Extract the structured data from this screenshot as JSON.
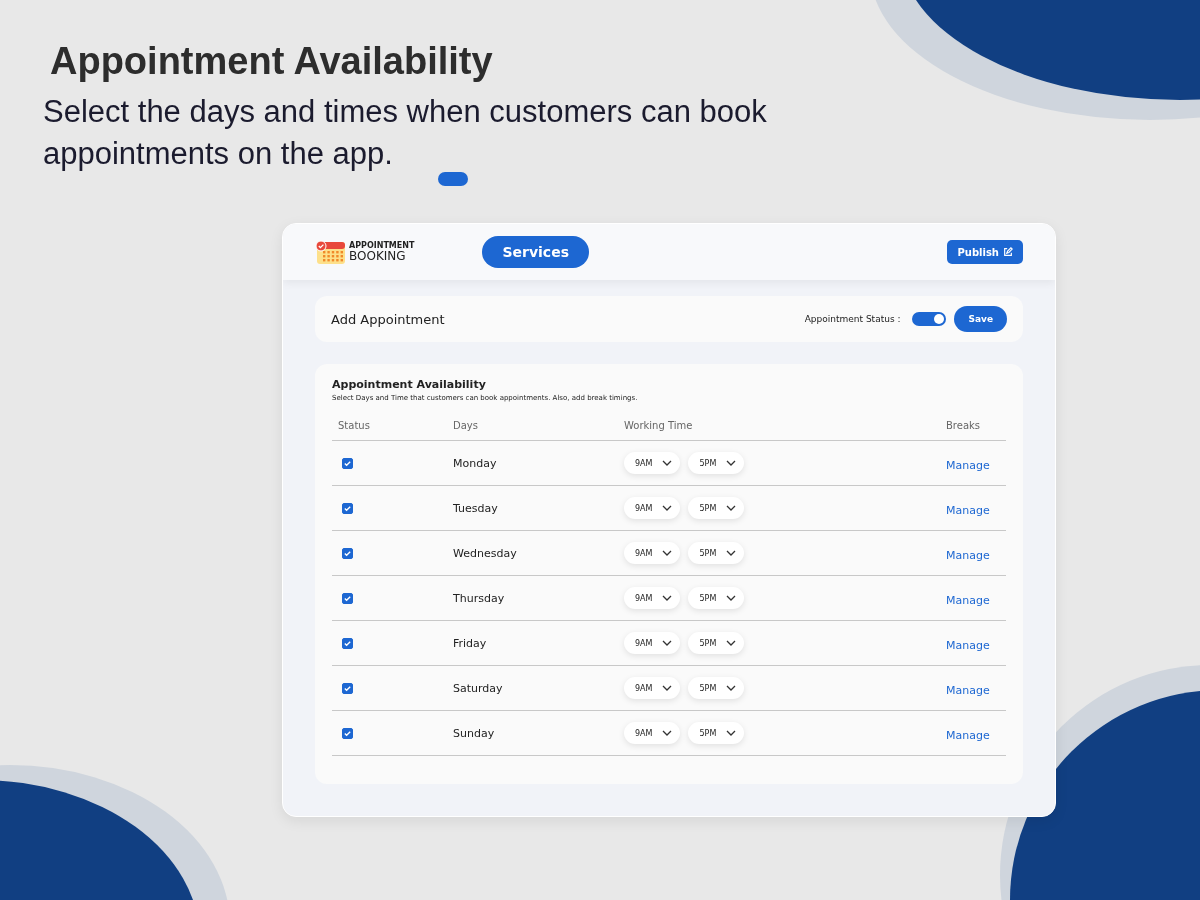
{
  "headline": "Appointment Availability",
  "subtitle": "Select the days and times when customers can book appointments on the app.",
  "app": {
    "logo": {
      "line_1": "APPOINTMENT",
      "line_2": "BOOKING"
    },
    "nav_button": "Services",
    "publish_button": "Publish",
    "add_bar": {
      "title": "Add Appointment",
      "status_label": "Appointment Status :",
      "status_on": true,
      "save_button": "Save"
    },
    "availability": {
      "title": "Appointment Availability",
      "description": "Select Days and Time that customers can book appointments. Also, add break timings.",
      "columns": [
        "Status",
        "Days",
        "Working Time",
        "Breaks"
      ],
      "rows": [
        {
          "checked": true,
          "day": "Monday",
          "start": "9AM",
          "end": "5PM",
          "breaks": "Manage"
        },
        {
          "checked": true,
          "day": "Tuesday",
          "start": "9AM",
          "end": "5PM",
          "breaks": "Manage"
        },
        {
          "checked": true,
          "day": "Wednesday",
          "start": "9AM",
          "end": "5PM",
          "breaks": "Manage"
        },
        {
          "checked": true,
          "day": "Thursday",
          "start": "9AM",
          "end": "5PM",
          "breaks": "Manage"
        },
        {
          "checked": true,
          "day": "Friday",
          "start": "9AM",
          "end": "5PM",
          "breaks": "Manage"
        },
        {
          "checked": true,
          "day": "Saturday",
          "start": "9AM",
          "end": "5PM",
          "breaks": "Manage"
        },
        {
          "checked": true,
          "day": "Sunday",
          "start": "9AM",
          "end": "5PM",
          "breaks": "Manage"
        }
      ]
    }
  }
}
